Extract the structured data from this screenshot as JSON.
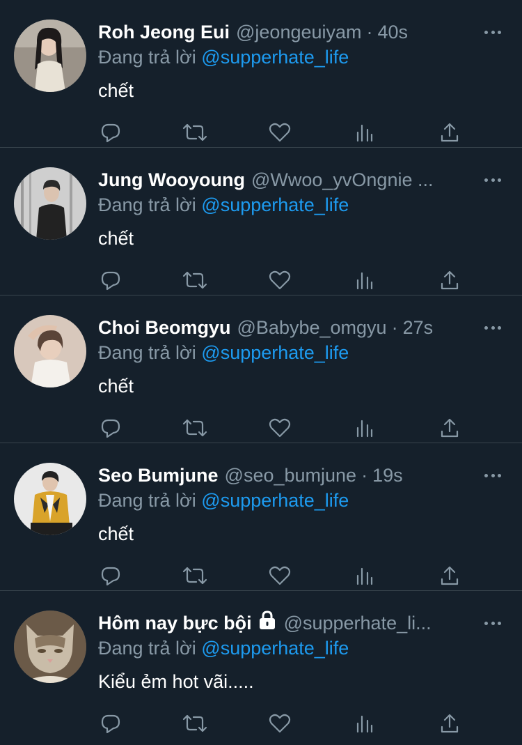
{
  "feed": {
    "reply_prefix": "Đang trả lời",
    "more_icon": "more-horizontal-icon",
    "action_icons": [
      "reply-icon",
      "retweet-icon",
      "like-icon",
      "analytics-icon",
      "share-icon"
    ],
    "colors": {
      "background": "#15202b",
      "secondary_text": "#8899a6",
      "mention": "#1d9bf0",
      "divider": "#38444d"
    },
    "tweets": [
      {
        "name": "Roh Jeong Eui",
        "handle": "@jeongeuiyam",
        "sep": "·",
        "time": "40s",
        "reply_to": "@supperhate_life",
        "text": "chết"
      },
      {
        "name": "Jung Wooyoung",
        "handle": "@Wwoo_yvOngnie ...",
        "sep": "",
        "time": "",
        "reply_to": "@supperhate_life",
        "text": "chết"
      },
      {
        "name": "Choi Beomgyu",
        "handle": "@Babybe_omgyu",
        "sep": "·",
        "time": "27s",
        "reply_to": "@supperhate_life",
        "text": "chết"
      },
      {
        "name": "Seo Bumjune",
        "handle": "@seo_bumjune",
        "sep": "·",
        "time": "19s",
        "reply_to": "@supperhate_life",
        "text": "chết"
      },
      {
        "name": "Hôm nay bực bội",
        "handle": "@supperhate_li...",
        "sep": "",
        "time": "",
        "reply_to": "@supperhate_life",
        "text": "Kiểu ẻm hot vãi....."
      }
    ]
  }
}
